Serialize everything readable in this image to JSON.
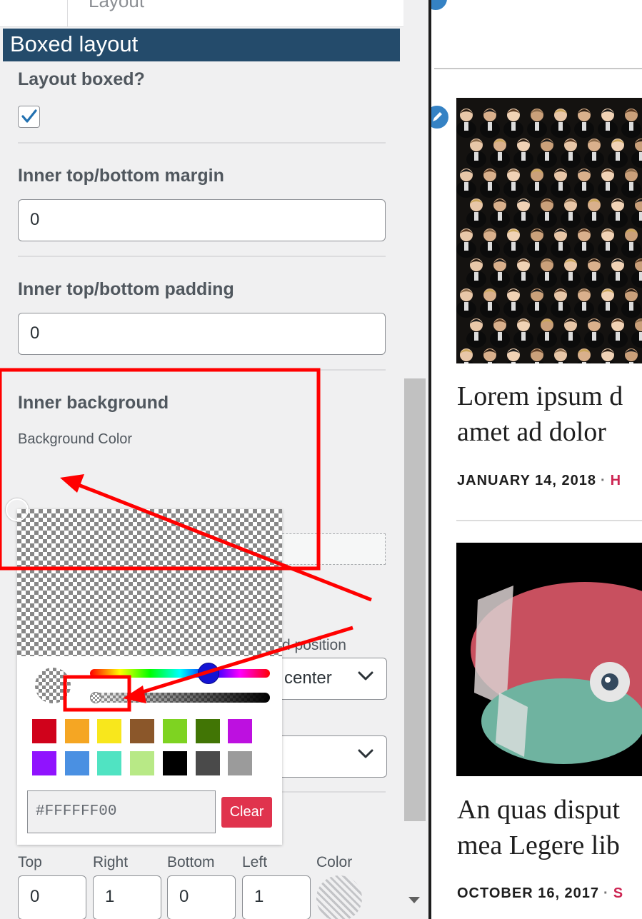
{
  "panel": {
    "breadcrumb": "Layout",
    "section_title": "Boxed layout",
    "layout_boxed_label": "Layout boxed?",
    "layout_boxed_checked": true,
    "margin_label": "Inner top/bottom margin",
    "margin_value": "0",
    "padding_label": "Inner top/bottom padding",
    "padding_value": "0",
    "inner_bg_label": "Inner background",
    "bg_color_label": "Background Color",
    "bg_position_label": "d position",
    "bg_position_value": "center",
    "border": {
      "top_label": "Top",
      "top_value": "0",
      "right_label": "Right",
      "right_value": "1",
      "bottom_label": "Bottom",
      "bottom_value": "0",
      "left_label": "Left",
      "left_value": "1",
      "color_label": "Color"
    }
  },
  "color_picker": {
    "hex_value": "#FFFFFF00",
    "clear_label": "Clear",
    "hue_color": "#1414d4",
    "swatches_row1": [
      "#d0021b",
      "#f5a623",
      "#f8e71c",
      "#8b572a",
      "#7ed321",
      "#417505",
      "#bd10e0"
    ],
    "swatches_row2": [
      "#9013fe",
      "#4a90e2",
      "#50e3c2",
      "#b8e986",
      "#000000",
      "#4a4a4a",
      "#9b9b9b"
    ]
  },
  "annotation_color": "#ff0000",
  "preview": {
    "post1": {
      "title_line1": "Lorem ipsum d",
      "title_line2": "amet ad dolor",
      "date": "JANUARY 14, 2018",
      "category": "H"
    },
    "post2": {
      "title_line1": "An quas disput",
      "title_line2": "mea Legere lib",
      "date": "OCTOBER 16, 2017",
      "category": "S"
    }
  }
}
